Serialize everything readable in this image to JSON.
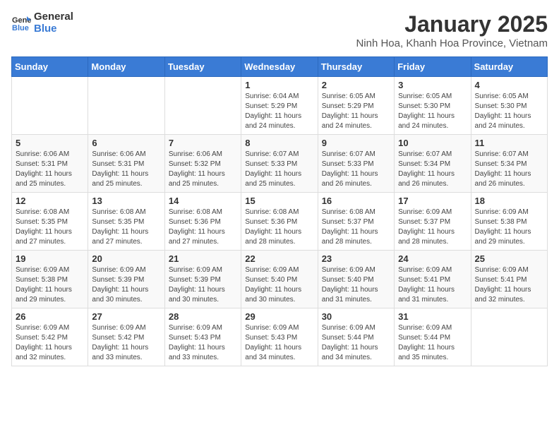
{
  "logo": {
    "text_general": "General",
    "text_blue": "Blue"
  },
  "title": "January 2025",
  "subtitle": "Ninh Hoa, Khanh Hoa Province, Vietnam",
  "days_of_week": [
    "Sunday",
    "Monday",
    "Tuesday",
    "Wednesday",
    "Thursday",
    "Friday",
    "Saturday"
  ],
  "weeks": [
    [
      {
        "day": "",
        "info": ""
      },
      {
        "day": "",
        "info": ""
      },
      {
        "day": "",
        "info": ""
      },
      {
        "day": "1",
        "info": "Sunrise: 6:04 AM\nSunset: 5:29 PM\nDaylight: 11 hours and 24 minutes."
      },
      {
        "day": "2",
        "info": "Sunrise: 6:05 AM\nSunset: 5:29 PM\nDaylight: 11 hours and 24 minutes."
      },
      {
        "day": "3",
        "info": "Sunrise: 6:05 AM\nSunset: 5:30 PM\nDaylight: 11 hours and 24 minutes."
      },
      {
        "day": "4",
        "info": "Sunrise: 6:05 AM\nSunset: 5:30 PM\nDaylight: 11 hours and 24 minutes."
      }
    ],
    [
      {
        "day": "5",
        "info": "Sunrise: 6:06 AM\nSunset: 5:31 PM\nDaylight: 11 hours and 25 minutes."
      },
      {
        "day": "6",
        "info": "Sunrise: 6:06 AM\nSunset: 5:31 PM\nDaylight: 11 hours and 25 minutes."
      },
      {
        "day": "7",
        "info": "Sunrise: 6:06 AM\nSunset: 5:32 PM\nDaylight: 11 hours and 25 minutes."
      },
      {
        "day": "8",
        "info": "Sunrise: 6:07 AM\nSunset: 5:33 PM\nDaylight: 11 hours and 25 minutes."
      },
      {
        "day": "9",
        "info": "Sunrise: 6:07 AM\nSunset: 5:33 PM\nDaylight: 11 hours and 26 minutes."
      },
      {
        "day": "10",
        "info": "Sunrise: 6:07 AM\nSunset: 5:34 PM\nDaylight: 11 hours and 26 minutes."
      },
      {
        "day": "11",
        "info": "Sunrise: 6:07 AM\nSunset: 5:34 PM\nDaylight: 11 hours and 26 minutes."
      }
    ],
    [
      {
        "day": "12",
        "info": "Sunrise: 6:08 AM\nSunset: 5:35 PM\nDaylight: 11 hours and 27 minutes."
      },
      {
        "day": "13",
        "info": "Sunrise: 6:08 AM\nSunset: 5:35 PM\nDaylight: 11 hours and 27 minutes."
      },
      {
        "day": "14",
        "info": "Sunrise: 6:08 AM\nSunset: 5:36 PM\nDaylight: 11 hours and 27 minutes."
      },
      {
        "day": "15",
        "info": "Sunrise: 6:08 AM\nSunset: 5:36 PM\nDaylight: 11 hours and 28 minutes."
      },
      {
        "day": "16",
        "info": "Sunrise: 6:08 AM\nSunset: 5:37 PM\nDaylight: 11 hours and 28 minutes."
      },
      {
        "day": "17",
        "info": "Sunrise: 6:09 AM\nSunset: 5:37 PM\nDaylight: 11 hours and 28 minutes."
      },
      {
        "day": "18",
        "info": "Sunrise: 6:09 AM\nSunset: 5:38 PM\nDaylight: 11 hours and 29 minutes."
      }
    ],
    [
      {
        "day": "19",
        "info": "Sunrise: 6:09 AM\nSunset: 5:38 PM\nDaylight: 11 hours and 29 minutes."
      },
      {
        "day": "20",
        "info": "Sunrise: 6:09 AM\nSunset: 5:39 PM\nDaylight: 11 hours and 30 minutes."
      },
      {
        "day": "21",
        "info": "Sunrise: 6:09 AM\nSunset: 5:39 PM\nDaylight: 11 hours and 30 minutes."
      },
      {
        "day": "22",
        "info": "Sunrise: 6:09 AM\nSunset: 5:40 PM\nDaylight: 11 hours and 30 minutes."
      },
      {
        "day": "23",
        "info": "Sunrise: 6:09 AM\nSunset: 5:40 PM\nDaylight: 11 hours and 31 minutes."
      },
      {
        "day": "24",
        "info": "Sunrise: 6:09 AM\nSunset: 5:41 PM\nDaylight: 11 hours and 31 minutes."
      },
      {
        "day": "25",
        "info": "Sunrise: 6:09 AM\nSunset: 5:41 PM\nDaylight: 11 hours and 32 minutes."
      }
    ],
    [
      {
        "day": "26",
        "info": "Sunrise: 6:09 AM\nSunset: 5:42 PM\nDaylight: 11 hours and 32 minutes."
      },
      {
        "day": "27",
        "info": "Sunrise: 6:09 AM\nSunset: 5:42 PM\nDaylight: 11 hours and 33 minutes."
      },
      {
        "day": "28",
        "info": "Sunrise: 6:09 AM\nSunset: 5:43 PM\nDaylight: 11 hours and 33 minutes."
      },
      {
        "day": "29",
        "info": "Sunrise: 6:09 AM\nSunset: 5:43 PM\nDaylight: 11 hours and 34 minutes."
      },
      {
        "day": "30",
        "info": "Sunrise: 6:09 AM\nSunset: 5:44 PM\nDaylight: 11 hours and 34 minutes."
      },
      {
        "day": "31",
        "info": "Sunrise: 6:09 AM\nSunset: 5:44 PM\nDaylight: 11 hours and 35 minutes."
      },
      {
        "day": "",
        "info": ""
      }
    ]
  ]
}
